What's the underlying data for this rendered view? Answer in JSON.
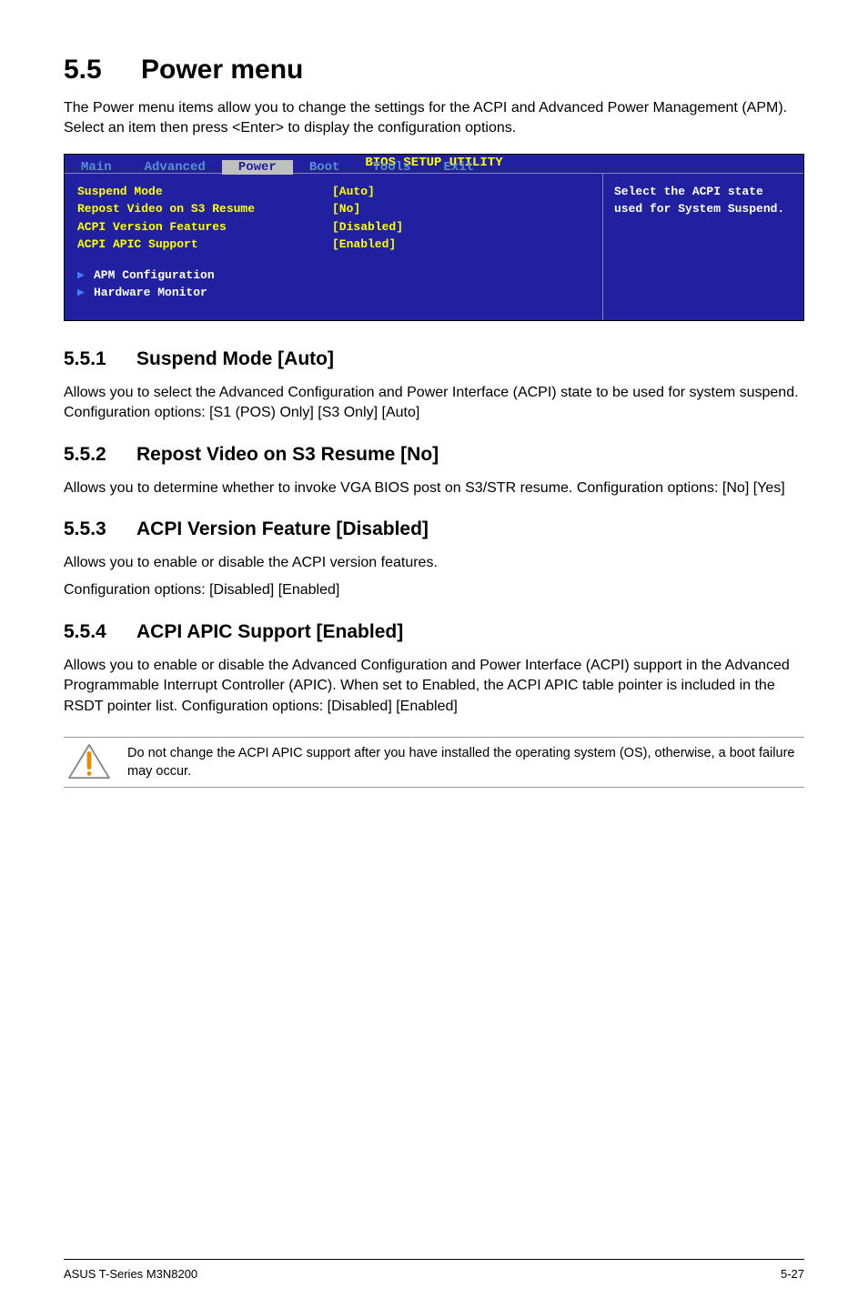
{
  "heading": {
    "num": "5.5",
    "title": "Power menu"
  },
  "intro": "The Power menu items allow you to change the settings for the ACPI and Advanced Power Management (APM). Select an item then press <Enter> to display the configuration options.",
  "bios": {
    "title": "BIOS SETUP UTILITY",
    "tabs": {
      "main": "Main",
      "advanced": "Advanced",
      "power": "Power",
      "boot": "Boot",
      "tools": "Tools",
      "exit": "Exit"
    },
    "rows": {
      "suspend": {
        "label": "Suspend Mode",
        "value": "[Auto]"
      },
      "repost": {
        "label": "Repost Video on S3 Resume",
        "value": "[No]"
      },
      "acpiver": {
        "label": "ACPI Version Features",
        "value": "[Disabled]"
      },
      "acpiapic": {
        "label": "ACPI APIC Support",
        "value": "[Enabled]"
      }
    },
    "subitems": {
      "apm": "APM Configuration",
      "hw": "Hardware Monitor"
    },
    "help": "Select the ACPI state used for System Suspend."
  },
  "sections": {
    "s1": {
      "num": "5.5.1",
      "title": "Suspend Mode [Auto]",
      "body": "Allows you to select the Advanced Configuration and Power Interface (ACPI) state to be used for system suspend.  Configuration options: [S1 (POS) Only] [S3 Only] [Auto]"
    },
    "s2": {
      "num": "5.5.2",
      "title": "Repost Video on S3 Resume [No]",
      "body": "Allows you to determine whether to invoke VGA BIOS post on S3/STR resume. Configuration options: [No] [Yes]"
    },
    "s3": {
      "num": "5.5.3",
      "title": "ACPI Version Feature [Disabled]",
      "body1": "Allows you to enable or disable the ACPI version features.",
      "body2": "Configuration options: [Disabled] [Enabled]"
    },
    "s4": {
      "num": "5.5.4",
      "title": "ACPI APIC Support [Enabled]",
      "body": "Allows you to enable or disable the Advanced Configuration and Power Interface (ACPI) support in the Advanced Programmable Interrupt Controller (APIC). When set to Enabled, the ACPI APIC table pointer is included in the RSDT pointer list. Configuration options: [Disabled] [Enabled]"
    }
  },
  "note": "Do not change the ACPI APIC support after you have installed the operating system (OS), otherwise, a boot failure may occur.",
  "footer": {
    "left": "ASUS T-Series M3N8200",
    "right": "5-27"
  }
}
